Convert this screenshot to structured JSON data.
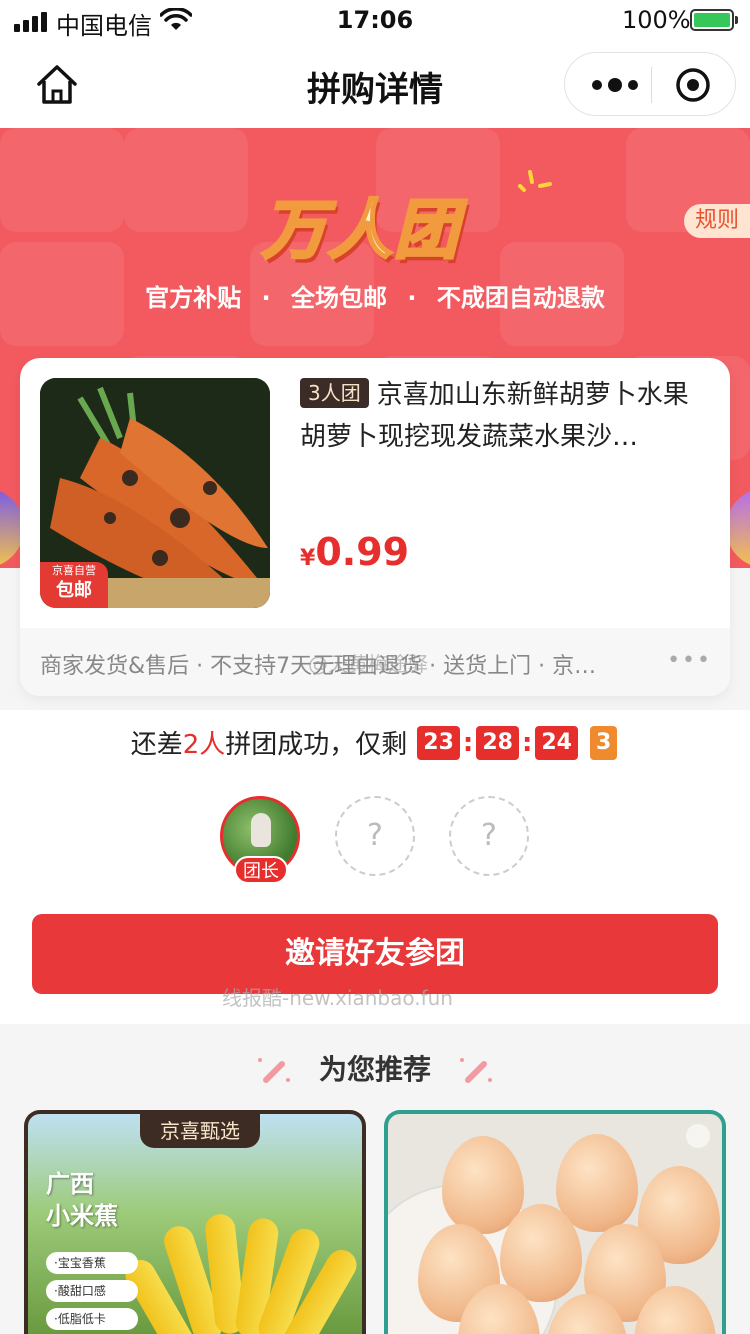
{
  "status_bar": {
    "carrier": "中国电信",
    "time": "17:06",
    "battery": "100%"
  },
  "nav": {
    "title": "拼购详情"
  },
  "banner": {
    "title": "万人团",
    "slogans": [
      "官方补贴",
      "全场包邮",
      "不成团自动退款"
    ],
    "separator": "·",
    "rule_label": "规则"
  },
  "product": {
    "group_tag": "3人团",
    "name": "京喜加山东新鲜胡萝卜水果胡萝卜现挖现发蔬菜水果沙…",
    "currency": "¥",
    "price": "0.99",
    "badge_top": "京喜自营",
    "badge_bottom": "包邮",
    "services": "商家发货&售后 · 不支持7天无理由退货 · 送货上门 · 京…",
    "more": "•••",
    "watermark": "@天黄梅途驿"
  },
  "countdown": {
    "prefix": "还差",
    "count": "2人",
    "suffix": "拼团成功，仅剩",
    "hours": "23",
    "minutes": "28",
    "seconds": "24",
    "tenths": "3",
    "colon": ":"
  },
  "members": {
    "leader_label": "团长",
    "empty_mark": "?"
  },
  "invite": {
    "label": "邀请好友参团",
    "watermark": "线报酷-new.xianbao.fun"
  },
  "recommend": {
    "title": "为您推荐",
    "card1": {
      "brand": "京喜甄选",
      "region_line1": "广西",
      "region_line2": "小米蕉",
      "features": [
        "·宝宝香蕉",
        "·酸甜口感",
        "·低脂低卡"
      ]
    }
  },
  "colors": {
    "accent_red": "#e62e2d",
    "banner_red": "#f25a5f",
    "orange_box": "#f08a2e"
  }
}
